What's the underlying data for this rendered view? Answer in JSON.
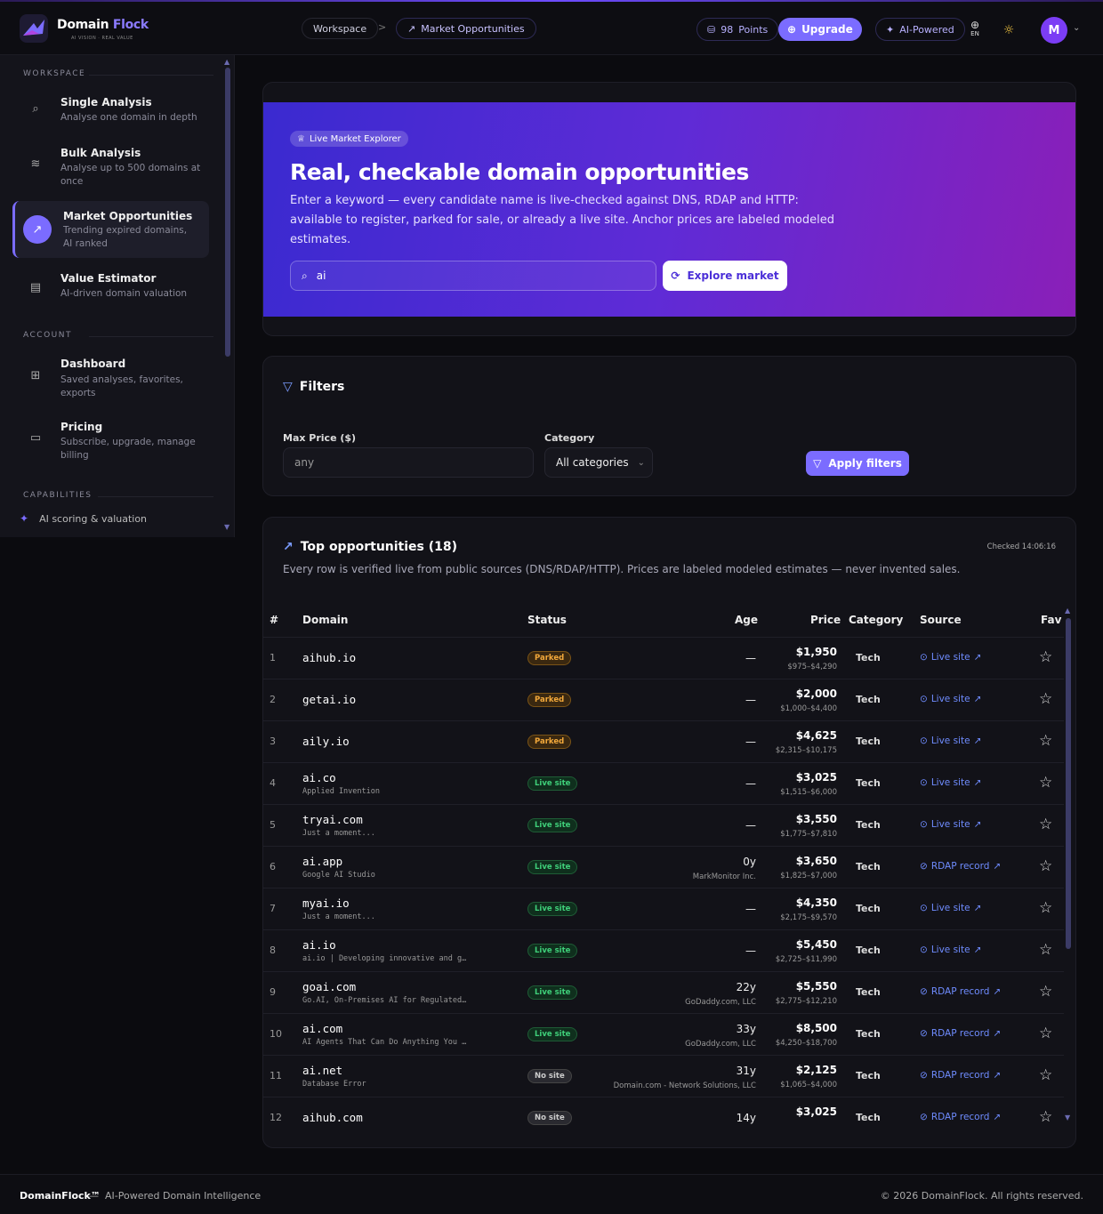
{
  "app": {
    "brand_main": "Domain ",
    "brand_accent": "Flock",
    "tagline": "AI VISION · REAL VALUE"
  },
  "header": {
    "crumb_workspace": "Workspace",
    "crumb_sep": ">",
    "crumb_current": "Market Opportunities",
    "points_value": "98",
    "points_label": "Points",
    "upgrade_label": "Upgrade",
    "ai_label": "AI-Powered",
    "lang": "EN",
    "avatar": "M"
  },
  "sidebar": {
    "workspace_label": "WORKSPACE",
    "items": [
      {
        "title": "Single Analysis",
        "desc": "Analyse one domain in depth",
        "icon": "search-icon"
      },
      {
        "title": "Bulk Analysis",
        "desc": "Analyse up to 500 domains at once",
        "icon": "layers-icon"
      },
      {
        "title": "Market Opportunities",
        "desc": "Trending expired domains, AI ranked",
        "icon": "trending-icon",
        "active": true
      },
      {
        "title": "Value Estimator",
        "desc": "AI-driven domain valuation",
        "icon": "calculator-icon"
      }
    ],
    "account_label": "ACCOUNT",
    "account_items": [
      {
        "title": "Dashboard",
        "desc": "Saved analyses, favorites, exports",
        "icon": "grid-icon"
      },
      {
        "title": "Pricing",
        "desc": "Subscribe, upgrade, manage billing",
        "icon": "card-icon"
      }
    ],
    "capabilities_label": "CAPABILITIES",
    "capability": "AI scoring & valuation"
  },
  "hero": {
    "badge": "Live Market Explorer",
    "title": "Real, checkable domain opportunities",
    "desc": "Enter a keyword — every candidate name is live-checked against DNS, RDAP and HTTP: available to register, parked for sale, or already a live site. Anchor prices are labeled modeled estimates.",
    "search_value": "ai",
    "button": "Explore market"
  },
  "filters": {
    "title": "Filters",
    "max_price_label": "Max Price ($)",
    "max_price_value": "any",
    "category_label": "Category",
    "category_value": "All categories",
    "apply_label": "Apply filters"
  },
  "table": {
    "title": "Top opportunities (18)",
    "checked": "Checked 14:06:16",
    "desc": "Every row is verified live from public sources (DNS/RDAP/HTTP). Prices are labeled modeled estimates — never invented sales.",
    "columns": {
      "num": "#",
      "domain": "Domain",
      "status": "Status",
      "age": "Age",
      "price": "Price",
      "category": "Category",
      "source": "Source",
      "fav": "Fav"
    },
    "rows": [
      {
        "n": "1",
        "domain": "aihub.io",
        "sub": "",
        "status": "Parked",
        "age": "—",
        "registrar": "",
        "price": "$1,950",
        "range": "$975–$4,290",
        "category": "Tech",
        "source": "Live site"
      },
      {
        "n": "2",
        "domain": "getai.io",
        "sub": "",
        "status": "Parked",
        "age": "—",
        "registrar": "",
        "price": "$2,000",
        "range": "$1,000–$4,400",
        "category": "Tech",
        "source": "Live site"
      },
      {
        "n": "3",
        "domain": "aily.io",
        "sub": "",
        "status": "Parked",
        "age": "—",
        "registrar": "",
        "price": "$4,625",
        "range": "$2,315–$10,175",
        "category": "Tech",
        "source": "Live site"
      },
      {
        "n": "4",
        "domain": "ai.co",
        "sub": "Applied Invention",
        "status": "Live site",
        "age": "—",
        "registrar": "",
        "price": "$3,025",
        "range": "$1,515–$6,000",
        "category": "Tech",
        "source": "Live site"
      },
      {
        "n": "5",
        "domain": "tryai.com",
        "sub": "Just a moment...",
        "status": "Live site",
        "age": "—",
        "registrar": "",
        "price": "$3,550",
        "range": "$1,775–$7,810",
        "category": "Tech",
        "source": "Live site"
      },
      {
        "n": "6",
        "domain": "ai.app",
        "sub": "Google AI Studio",
        "status": "Live site",
        "age": "0y",
        "registrar": "MarkMonitor Inc.",
        "price": "$3,650",
        "range": "$1,825–$7,000",
        "category": "Tech",
        "source": "RDAP record"
      },
      {
        "n": "7",
        "domain": "myai.io",
        "sub": "Just a moment...",
        "status": "Live site",
        "age": "—",
        "registrar": "",
        "price": "$4,350",
        "range": "$2,175–$9,570",
        "category": "Tech",
        "source": "Live site"
      },
      {
        "n": "8",
        "domain": "ai.io",
        "sub": "ai.io | Developing innovative and g…",
        "status": "Live site",
        "age": "—",
        "registrar": "",
        "price": "$5,450",
        "range": "$2,725–$11,990",
        "category": "Tech",
        "source": "Live site"
      },
      {
        "n": "9",
        "domain": "goai.com",
        "sub": "Go.AI, On-Premises AI for Regulated…",
        "status": "Live site",
        "age": "22y",
        "registrar": "GoDaddy.com, LLC",
        "price": "$5,550",
        "range": "$2,775–$12,210",
        "category": "Tech",
        "source": "RDAP record"
      },
      {
        "n": "10",
        "domain": "ai.com",
        "sub": "AI Agents That Can Do Anything You …",
        "status": "Live site",
        "age": "33y",
        "registrar": "GoDaddy.com, LLC",
        "price": "$8,500",
        "range": "$4,250–$18,700",
        "category": "Tech",
        "source": "RDAP record"
      },
      {
        "n": "11",
        "domain": "ai.net",
        "sub": "Database Error",
        "status": "No site",
        "age": "31y",
        "registrar": "Domain.com - Network Solutions, LLC",
        "price": "$2,125",
        "range": "$1,065–$4,000",
        "category": "Tech",
        "source": "RDAP record"
      },
      {
        "n": "12",
        "domain": "aihub.com",
        "sub": "",
        "status": "No site",
        "age": "14y",
        "registrar": "",
        "price": "$3,025",
        "range": "",
        "category": "Tech",
        "source": "RDAP record"
      }
    ]
  },
  "footer": {
    "brand": "DomainFlock™",
    "sep": "—",
    "tagline": "AI-Powered Domain Intelligence",
    "copyright": "© 2026 DomainFlock. All rights reserved."
  },
  "colors": {
    "accent": "#7b6cff",
    "parked": "#f3a93b",
    "live": "#3fd07a"
  }
}
